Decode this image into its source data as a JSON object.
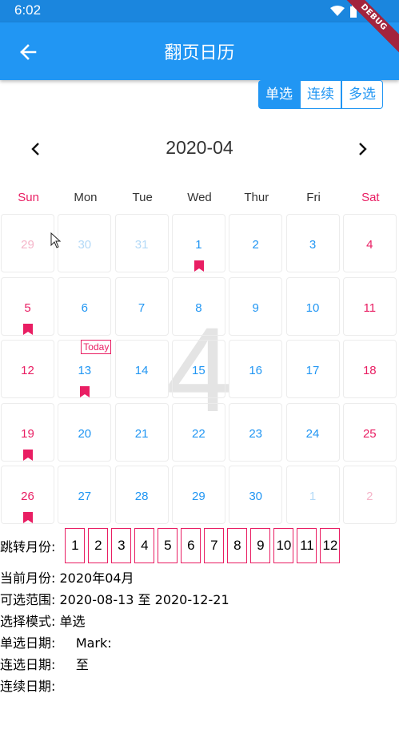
{
  "status_bar": {
    "time": "6:02"
  },
  "app_bar": {
    "title": "翻页日历",
    "debug_banner": "DEBUG"
  },
  "modes": {
    "single": "单选",
    "continuous": "连续",
    "multi": "多选",
    "active": "single"
  },
  "calendar": {
    "month_title": "2020-04",
    "big_month": "4",
    "weekdays": [
      "Sun",
      "Mon",
      "Tue",
      "Wed",
      "Thur",
      "Fri",
      "Sat"
    ],
    "today_label": "Today",
    "rows": [
      [
        {
          "d": "29",
          "color": "pink-faded"
        },
        {
          "d": "30",
          "color": "blue-faded"
        },
        {
          "d": "31",
          "color": "blue-faded"
        },
        {
          "d": "1",
          "color": "blue",
          "mark": true
        },
        {
          "d": "2",
          "color": "blue"
        },
        {
          "d": "3",
          "color": "blue"
        },
        {
          "d": "4",
          "color": "pink"
        }
      ],
      [
        {
          "d": "5",
          "color": "pink",
          "mark": true
        },
        {
          "d": "6",
          "color": "blue"
        },
        {
          "d": "7",
          "color": "blue"
        },
        {
          "d": "8",
          "color": "blue"
        },
        {
          "d": "9",
          "color": "blue"
        },
        {
          "d": "10",
          "color": "blue"
        },
        {
          "d": "11",
          "color": "pink"
        }
      ],
      [
        {
          "d": "12",
          "color": "pink"
        },
        {
          "d": "13",
          "color": "blue",
          "mark": true,
          "today": true
        },
        {
          "d": "14",
          "color": "blue"
        },
        {
          "d": "15",
          "color": "blue"
        },
        {
          "d": "16",
          "color": "blue"
        },
        {
          "d": "17",
          "color": "blue"
        },
        {
          "d": "18",
          "color": "pink"
        }
      ],
      [
        {
          "d": "19",
          "color": "pink",
          "mark": true
        },
        {
          "d": "20",
          "color": "blue"
        },
        {
          "d": "21",
          "color": "blue"
        },
        {
          "d": "22",
          "color": "blue"
        },
        {
          "d": "23",
          "color": "blue"
        },
        {
          "d": "24",
          "color": "blue"
        },
        {
          "d": "25",
          "color": "pink"
        }
      ],
      [
        {
          "d": "26",
          "color": "pink",
          "mark": true
        },
        {
          "d": "27",
          "color": "blue"
        },
        {
          "d": "28",
          "color": "blue"
        },
        {
          "d": "29",
          "color": "blue"
        },
        {
          "d": "30",
          "color": "blue"
        },
        {
          "d": "1",
          "color": "blue-faded"
        },
        {
          "d": "2",
          "color": "pink-faded"
        }
      ]
    ]
  },
  "jump": {
    "label": "跳转月份:",
    "months": [
      "1",
      "2",
      "3",
      "4",
      "5",
      "6",
      "7",
      "8",
      "9",
      "10",
      "11",
      "12"
    ]
  },
  "info": {
    "current_month": "当前月份: 2020年04月",
    "range": "可选范围: 2020-08-13 至  2020-12-21",
    "mode": "选择模式: 单选",
    "single_date": "单选日期:     Mark:",
    "multi_dates": "连选日期:     至",
    "continuous_dates": "连续日期:"
  },
  "colors": {
    "primary": "#2196f3",
    "accent": "#e91e63"
  }
}
